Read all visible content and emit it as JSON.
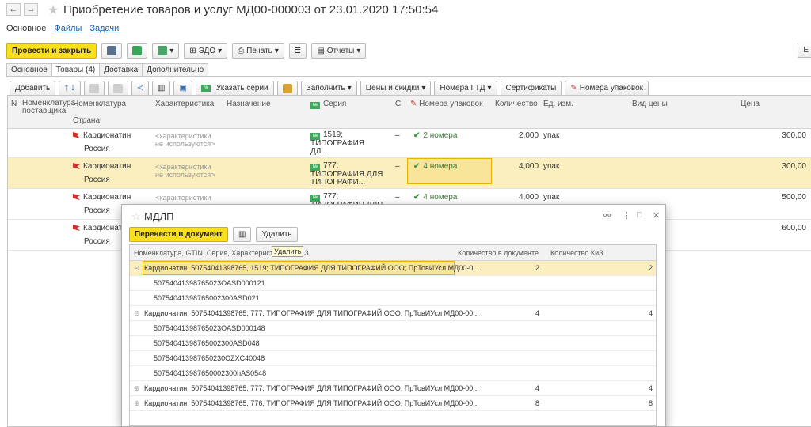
{
  "window": {
    "title": "Приобретение товаров и услуг МД00-000003 от 23.01.2020 17:50:54",
    "back": "←",
    "forward": "→"
  },
  "nav": {
    "main": "Основное",
    "files": "Файлы",
    "tasks": "Задачи"
  },
  "toolbar": {
    "post_close": "Провести и закрыть",
    "edo": "ЭДО",
    "print": "Печать",
    "reports": "Отчеты",
    "more": "Е"
  },
  "tabs": [
    "Основное",
    "Товары (4)",
    "Доставка",
    "Дополнительно"
  ],
  "table_toolbar": {
    "add": "Добавить",
    "series": "Указать серии",
    "fill": "Заполнить",
    "prices": "Цены и скидки",
    "gtd": "Номера ГТД",
    "certs": "Сертификаты",
    "packages": "Номера упаковок"
  },
  "columns": {
    "n": "N",
    "supplier_nom": "Номенклатура поставщика",
    "nom": "Номенклатура",
    "country": "Страна",
    "char": "Характеристика",
    "purpose": "Назначение",
    "series": "Серия",
    "c": "С",
    "pack": "Номера упаковок",
    "qty": "Количество",
    "unit": "Ед. изм.",
    "price_type": "Вид цены",
    "price": "Цена"
  },
  "rows": [
    {
      "nom": "Кардионатин",
      "country": "Россия",
      "char": "<характеристики не используются>",
      "series": "1519; ТИПОГРАФИЯ ДЛ...",
      "c": "–",
      "pack": "2 номера",
      "qty": "2,000",
      "unit": "упак",
      "price": "300,00"
    },
    {
      "nom": "Кардионатин",
      "country": "Россия",
      "char": "<характеристики не используются>",
      "series": "777; ТИПОГРАФИЯ ДЛЯ ТИПОГРАФИ...",
      "c": "–",
      "pack": "4 номера",
      "qty": "4,000",
      "unit": "упак",
      "price": "300,00"
    },
    {
      "nom": "Кардионатин",
      "country": "Россия",
      "char": "<характеристики не используются>",
      "series": "777; ТИПОГРАФИЯ ДЛЯ ТИПОГРАФИ...",
      "c": "–",
      "pack": "4 номера",
      "qty": "4,000",
      "unit": "упак",
      "price": "500,00"
    },
    {
      "nom": "Кардионати",
      "country": "Россия",
      "price": "600,00"
    }
  ],
  "dialog": {
    "title": "МДЛП",
    "transfer": "Перенести в документ",
    "delete": "Удалить",
    "tooltip": "Удалить",
    "col_name": "Номенклатура, GTIN, Серия, Характеристика,",
    "col_name_tail": "З",
    "col_doc": "Количество в документе",
    "col_kiz": "Количество КиЗ",
    "rows": [
      {
        "exp": "⊖",
        "text": "Кардионатин, 50754041398765, 1519; ТИПОГРАФИЯ ДЛЯ ТИПОГРАФИЙ ООО; ПрТовИУсл МД00-0...",
        "doc": "2",
        "kiz": "2"
      },
      {
        "text": "50754041398765023OASD000121"
      },
      {
        "text": "50754041398765002300ASD021"
      },
      {
        "exp": "⊖",
        "text": "Кардионатин, 50754041398765, 777; ТИПОГРАФИЯ ДЛЯ ТИПОГРАФИЙ ООО; ПрТовИУсл МД00-00...",
        "doc": "4",
        "kiz": "4"
      },
      {
        "text": "50754041398765023OASD000148"
      },
      {
        "text": "50754041398765002300ASD048"
      },
      {
        "text": "507540413987650230OZXC40048"
      },
      {
        "text": "507540413987650002300hAS0548"
      },
      {
        "exp": "⊕",
        "text": "Кардионатин, 50754041398765, 777; ТИПОГРАФИЯ ДЛЯ ТИПОГРАФИЙ ООО; ПрТовИУсл МД00-00...",
        "doc": "4",
        "kiz": "4"
      },
      {
        "exp": "⊕",
        "text": "Кардионатин, 50754041398765, 776; ТИПОГРАФИЯ ДЛЯ ТИПОГРАФИЙ ООО; ПрТовИУсл МД00-00...",
        "doc": "8",
        "kiz": "8"
      }
    ]
  }
}
